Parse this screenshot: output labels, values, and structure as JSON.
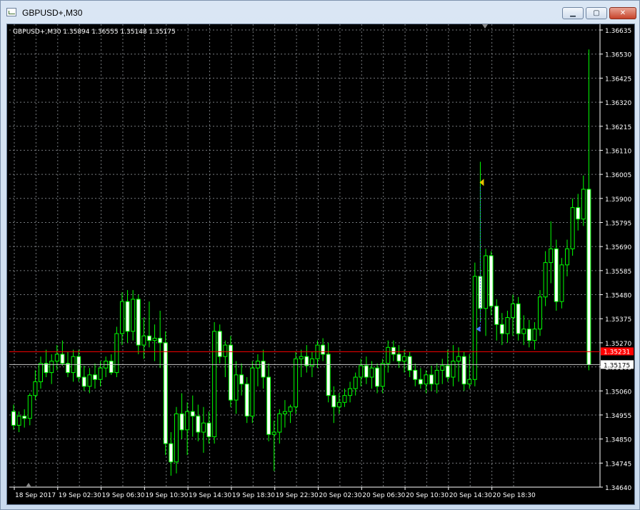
{
  "window": {
    "title": "GBPUSD+,M30",
    "icon": "chart-window-icon",
    "controls": {
      "minimize": "▁",
      "maximize": "▢",
      "close": "✕"
    }
  },
  "chart": {
    "info_label": "GBPUSD+,M30  1.35894 1.36555 1.35148 1.35175",
    "bid_label": "1.35175",
    "red_line_label": "1.35231",
    "colors": {
      "background": "#000000",
      "bull": "#00ff00",
      "bear": "#00ff00",
      "grid": "#9ea3a8",
      "red_line": "#ff0000"
    }
  },
  "chart_data": {
    "type": "candlestick",
    "y_ticks": [
      "1.36635",
      "1.36530",
      "1.36425",
      "1.36320",
      "1.36215",
      "1.36110",
      "1.36005",
      "1.35900",
      "1.35795",
      "1.35690",
      "1.35585",
      "1.35480",
      "1.35375",
      "1.35270",
      "1.35165",
      "1.35060",
      "1.34955",
      "1.34850",
      "1.34745",
      "1.34640"
    ],
    "ylim": [
      1.3464,
      1.3666
    ],
    "x_ticks": [
      "18 Sep 2017",
      "19 Sep 02:30",
      "19 Sep 06:30",
      "19 Sep 10:30",
      "19 Sep 14:30",
      "19 Sep 18:30",
      "19 Sep 22:30",
      "20 Sep 02:30",
      "20 Sep 06:30",
      "20 Sep 10:30",
      "20 Sep 14:30",
      "20 Sep 18:30"
    ],
    "current_price": 1.35175,
    "red_line_price": 1.35231,
    "candles": [
      {
        "o": 1.3497,
        "h": 1.35,
        "l": 1.3489,
        "c": 1.3491
      },
      {
        "o": 1.3491,
        "h": 1.3497,
        "l": 1.3488,
        "c": 1.3495
      },
      {
        "o": 1.3495,
        "h": 1.3498,
        "l": 1.349,
        "c": 1.3494
      },
      {
        "o": 1.3494,
        "h": 1.3505,
        "l": 1.3491,
        "c": 1.3504
      },
      {
        "o": 1.3504,
        "h": 1.3515,
        "l": 1.3502,
        "c": 1.351
      },
      {
        "o": 1.351,
        "h": 1.3521,
        "l": 1.3507,
        "c": 1.3518
      },
      {
        "o": 1.3518,
        "h": 1.3524,
        "l": 1.3512,
        "c": 1.3514
      },
      {
        "o": 1.3514,
        "h": 1.3522,
        "l": 1.3509,
        "c": 1.3519
      },
      {
        "o": 1.3519,
        "h": 1.3526,
        "l": 1.3515,
        "c": 1.3522
      },
      {
        "o": 1.3522,
        "h": 1.3528,
        "l": 1.3517,
        "c": 1.3518
      },
      {
        "o": 1.3518,
        "h": 1.3523,
        "l": 1.3512,
        "c": 1.3514
      },
      {
        "o": 1.3514,
        "h": 1.3524,
        "l": 1.351,
        "c": 1.3521
      },
      {
        "o": 1.3521,
        "h": 1.3524,
        "l": 1.351,
        "c": 1.3512
      },
      {
        "o": 1.3512,
        "h": 1.3517,
        "l": 1.3506,
        "c": 1.3508
      },
      {
        "o": 1.3508,
        "h": 1.3516,
        "l": 1.3505,
        "c": 1.3513
      },
      {
        "o": 1.3513,
        "h": 1.3518,
        "l": 1.3507,
        "c": 1.3511
      },
      {
        "o": 1.3511,
        "h": 1.3519,
        "l": 1.3508,
        "c": 1.3516
      },
      {
        "o": 1.3516,
        "h": 1.3521,
        "l": 1.3512,
        "c": 1.3519
      },
      {
        "o": 1.3519,
        "h": 1.3522,
        "l": 1.3513,
        "c": 1.3514
      },
      {
        "o": 1.3514,
        "h": 1.3534,
        "l": 1.3512,
        "c": 1.3531
      },
      {
        "o": 1.3531,
        "h": 1.3549,
        "l": 1.3526,
        "c": 1.3545
      },
      {
        "o": 1.3545,
        "h": 1.355,
        "l": 1.3527,
        "c": 1.3532
      },
      {
        "o": 1.3532,
        "h": 1.355,
        "l": 1.3528,
        "c": 1.3546
      },
      {
        "o": 1.3546,
        "h": 1.3548,
        "l": 1.3522,
        "c": 1.3526
      },
      {
        "o": 1.3526,
        "h": 1.3538,
        "l": 1.352,
        "c": 1.353
      },
      {
        "o": 1.353,
        "h": 1.3545,
        "l": 1.3525,
        "c": 1.3528
      },
      {
        "o": 1.3528,
        "h": 1.3535,
        "l": 1.3519,
        "c": 1.3529
      },
      {
        "o": 1.3529,
        "h": 1.3541,
        "l": 1.3516,
        "c": 1.3527
      },
      {
        "o": 1.3527,
        "h": 1.3532,
        "l": 1.3478,
        "c": 1.3483
      },
      {
        "o": 1.3483,
        "h": 1.3488,
        "l": 1.3469,
        "c": 1.3475
      },
      {
        "o": 1.3475,
        "h": 1.3499,
        "l": 1.347,
        "c": 1.3496
      },
      {
        "o": 1.3496,
        "h": 1.3505,
        "l": 1.3485,
        "c": 1.3489
      },
      {
        "o": 1.3489,
        "h": 1.3501,
        "l": 1.3478,
        "c": 1.3497
      },
      {
        "o": 1.3497,
        "h": 1.3504,
        "l": 1.3486,
        "c": 1.3495
      },
      {
        "o": 1.3495,
        "h": 1.35,
        "l": 1.3484,
        "c": 1.3488
      },
      {
        "o": 1.3488,
        "h": 1.3499,
        "l": 1.3479,
        "c": 1.3492
      },
      {
        "o": 1.3492,
        "h": 1.3497,
        "l": 1.3483,
        "c": 1.3486
      },
      {
        "o": 1.3486,
        "h": 1.3536,
        "l": 1.3483,
        "c": 1.3532
      },
      {
        "o": 1.3532,
        "h": 1.3535,
        "l": 1.3518,
        "c": 1.3521
      },
      {
        "o": 1.3521,
        "h": 1.3528,
        "l": 1.3512,
        "c": 1.3526
      },
      {
        "o": 1.3526,
        "h": 1.353,
        "l": 1.3499,
        "c": 1.3502
      },
      {
        "o": 1.3502,
        "h": 1.3519,
        "l": 1.3496,
        "c": 1.3513
      },
      {
        "o": 1.3513,
        "h": 1.3518,
        "l": 1.3504,
        "c": 1.3509
      },
      {
        "o": 1.3509,
        "h": 1.3512,
        "l": 1.3492,
        "c": 1.3495
      },
      {
        "o": 1.3495,
        "h": 1.3519,
        "l": 1.3492,
        "c": 1.3516
      },
      {
        "o": 1.3516,
        "h": 1.3522,
        "l": 1.3508,
        "c": 1.3519
      },
      {
        "o": 1.3519,
        "h": 1.3524,
        "l": 1.3507,
        "c": 1.3512
      },
      {
        "o": 1.3512,
        "h": 1.3518,
        "l": 1.3484,
        "c": 1.3487
      },
      {
        "o": 1.3487,
        "h": 1.3493,
        "l": 1.3471,
        "c": 1.3488
      },
      {
        "o": 1.3488,
        "h": 1.3498,
        "l": 1.3483,
        "c": 1.3496
      },
      {
        "o": 1.3496,
        "h": 1.3502,
        "l": 1.349,
        "c": 1.3497
      },
      {
        "o": 1.3497,
        "h": 1.35,
        "l": 1.3492,
        "c": 1.3499
      },
      {
        "o": 1.3499,
        "h": 1.3523,
        "l": 1.3496,
        "c": 1.352
      },
      {
        "o": 1.352,
        "h": 1.3524,
        "l": 1.3512,
        "c": 1.3521
      },
      {
        "o": 1.3521,
        "h": 1.3526,
        "l": 1.3514,
        "c": 1.3517
      },
      {
        "o": 1.3517,
        "h": 1.3523,
        "l": 1.3512,
        "c": 1.352
      },
      {
        "o": 1.352,
        "h": 1.3528,
        "l": 1.3516,
        "c": 1.3526
      },
      {
        "o": 1.3526,
        "h": 1.3529,
        "l": 1.3519,
        "c": 1.3522
      },
      {
        "o": 1.3522,
        "h": 1.3527,
        "l": 1.3501,
        "c": 1.3504
      },
      {
        "o": 1.3504,
        "h": 1.3508,
        "l": 1.3492,
        "c": 1.3499
      },
      {
        "o": 1.3499,
        "h": 1.3505,
        "l": 1.3496,
        "c": 1.3501
      },
      {
        "o": 1.3501,
        "h": 1.3507,
        "l": 1.3499,
        "c": 1.3504
      },
      {
        "o": 1.3504,
        "h": 1.351,
        "l": 1.3501,
        "c": 1.3507
      },
      {
        "o": 1.3507,
        "h": 1.3514,
        "l": 1.3504,
        "c": 1.3512
      },
      {
        "o": 1.3512,
        "h": 1.352,
        "l": 1.3508,
        "c": 1.3517
      },
      {
        "o": 1.3517,
        "h": 1.3521,
        "l": 1.3509,
        "c": 1.3512
      },
      {
        "o": 1.3512,
        "h": 1.3519,
        "l": 1.3507,
        "c": 1.3516
      },
      {
        "o": 1.3516,
        "h": 1.3518,
        "l": 1.3505,
        "c": 1.3508
      },
      {
        "o": 1.3508,
        "h": 1.352,
        "l": 1.3505,
        "c": 1.3518
      },
      {
        "o": 1.3518,
        "h": 1.3528,
        "l": 1.3514,
        "c": 1.3525
      },
      {
        "o": 1.3525,
        "h": 1.3528,
        "l": 1.3519,
        "c": 1.3522
      },
      {
        "o": 1.3522,
        "h": 1.3526,
        "l": 1.3516,
        "c": 1.3519
      },
      {
        "o": 1.3519,
        "h": 1.3524,
        "l": 1.3514,
        "c": 1.3521
      },
      {
        "o": 1.3521,
        "h": 1.3523,
        "l": 1.3512,
        "c": 1.3515
      },
      {
        "o": 1.3515,
        "h": 1.3518,
        "l": 1.3508,
        "c": 1.3511
      },
      {
        "o": 1.3511,
        "h": 1.3516,
        "l": 1.3507,
        "c": 1.3509
      },
      {
        "o": 1.3509,
        "h": 1.3515,
        "l": 1.3505,
        "c": 1.3513
      },
      {
        "o": 1.3513,
        "h": 1.3517,
        "l": 1.3506,
        "c": 1.3509
      },
      {
        "o": 1.3509,
        "h": 1.3518,
        "l": 1.3505,
        "c": 1.3515
      },
      {
        "o": 1.3515,
        "h": 1.352,
        "l": 1.3509,
        "c": 1.3517
      },
      {
        "o": 1.3517,
        "h": 1.3524,
        "l": 1.351,
        "c": 1.3512
      },
      {
        "o": 1.3512,
        "h": 1.3526,
        "l": 1.3508,
        "c": 1.3519
      },
      {
        "o": 1.3519,
        "h": 1.3525,
        "l": 1.351,
        "c": 1.3521
      },
      {
        "o": 1.3521,
        "h": 1.3523,
        "l": 1.3506,
        "c": 1.3509
      },
      {
        "o": 1.3509,
        "h": 1.3522,
        "l": 1.3507,
        "c": 1.3511
      },
      {
        "o": 1.3511,
        "h": 1.3562,
        "l": 1.3508,
        "c": 1.3556
      },
      {
        "o": 1.3556,
        "h": 1.3606,
        "l": 1.3536,
        "c": 1.3542
      },
      {
        "o": 1.3542,
        "h": 1.3568,
        "l": 1.353,
        "c": 1.3565
      },
      {
        "o": 1.3565,
        "h": 1.3567,
        "l": 1.3539,
        "c": 1.3543
      },
      {
        "o": 1.3543,
        "h": 1.3546,
        "l": 1.3528,
        "c": 1.3535
      },
      {
        "o": 1.3535,
        "h": 1.354,
        "l": 1.3526,
        "c": 1.3531
      },
      {
        "o": 1.3531,
        "h": 1.3541,
        "l": 1.3527,
        "c": 1.3538
      },
      {
        "o": 1.3538,
        "h": 1.3548,
        "l": 1.353,
        "c": 1.3544
      },
      {
        "o": 1.3544,
        "h": 1.3547,
        "l": 1.3528,
        "c": 1.3531
      },
      {
        "o": 1.3531,
        "h": 1.3539,
        "l": 1.3526,
        "c": 1.3533
      },
      {
        "o": 1.3533,
        "h": 1.3537,
        "l": 1.3525,
        "c": 1.3528
      },
      {
        "o": 1.3528,
        "h": 1.3536,
        "l": 1.3524,
        "c": 1.3533
      },
      {
        "o": 1.3533,
        "h": 1.355,
        "l": 1.353,
        "c": 1.3547
      },
      {
        "o": 1.3547,
        "h": 1.3567,
        "l": 1.3543,
        "c": 1.3562
      },
      {
        "o": 1.3562,
        "h": 1.358,
        "l": 1.3553,
        "c": 1.3568
      },
      {
        "o": 1.3568,
        "h": 1.3572,
        "l": 1.3541,
        "c": 1.3545
      },
      {
        "o": 1.3545,
        "h": 1.3564,
        "l": 1.3542,
        "c": 1.3561
      },
      {
        "o": 1.3561,
        "h": 1.3572,
        "l": 1.3556,
        "c": 1.3568
      },
      {
        "o": 1.3568,
        "h": 1.359,
        "l": 1.3565,
        "c": 1.3586
      },
      {
        "o": 1.3586,
        "h": 1.3592,
        "l": 1.3576,
        "c": 1.3581
      },
      {
        "o": 1.3581,
        "h": 1.36,
        "l": 1.3578,
        "c": 1.3594
      },
      {
        "o": 1.3594,
        "h": 1.3655,
        "l": 1.3515,
        "c": 1.35175
      }
    ]
  }
}
